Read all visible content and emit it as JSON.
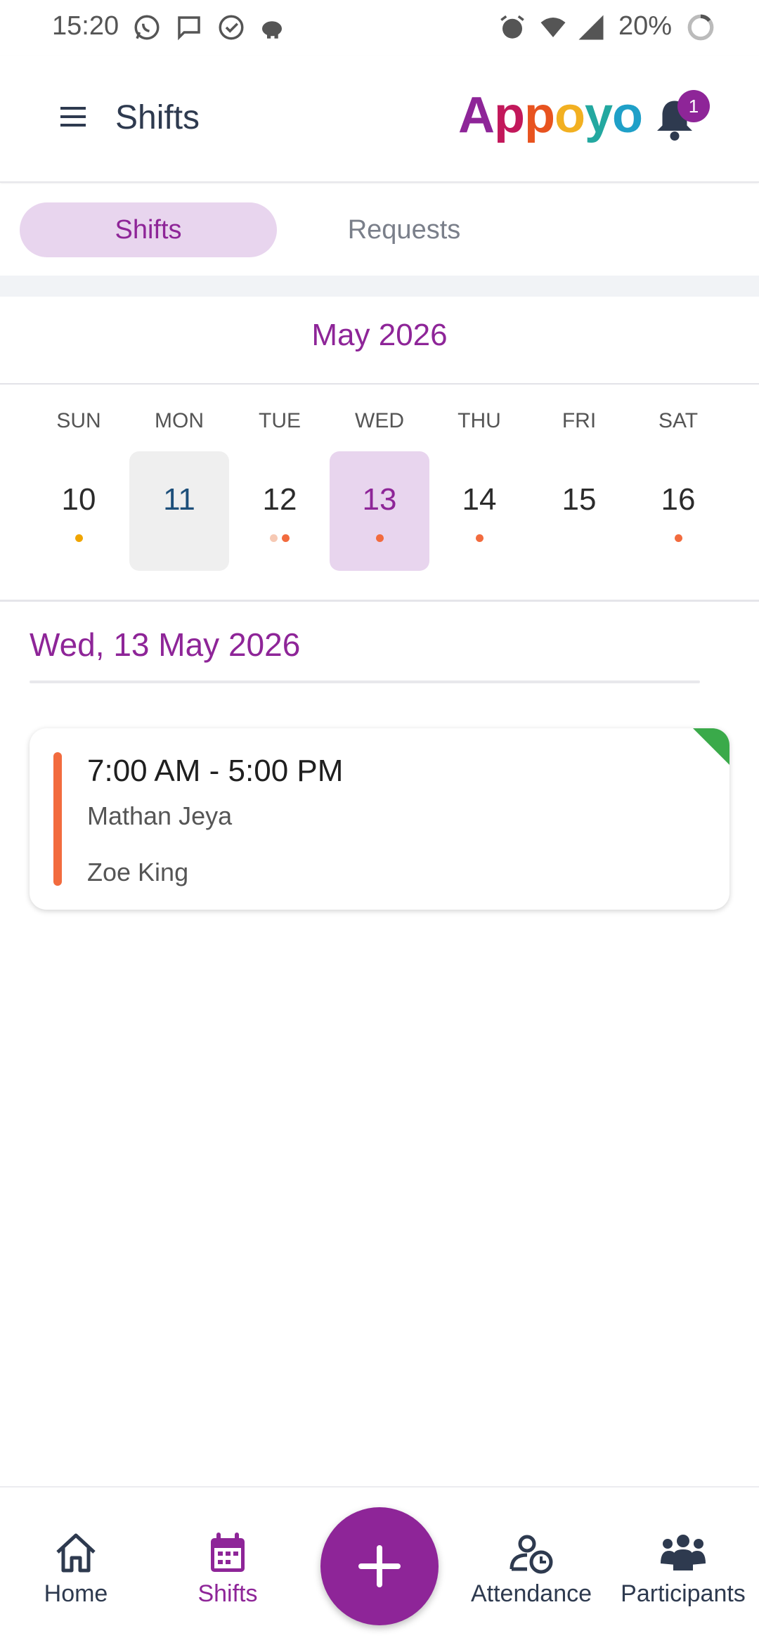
{
  "status_bar": {
    "time": "15:20",
    "battery": "20%"
  },
  "app_bar": {
    "title": "Shifts",
    "brand": [
      "A",
      "p",
      "p",
      "o",
      "y",
      "o"
    ],
    "brand_colors": [
      "#8e2598",
      "#c2185b",
      "#e8531f",
      "#f2b021",
      "#23a8a0",
      "#1fa0c8"
    ],
    "notification_count": "1"
  },
  "tabs": {
    "shifts": "Shifts",
    "requests": "Requests"
  },
  "calendar": {
    "month": "May 2026",
    "days": [
      {
        "dow": "SUN",
        "date": "10",
        "dots": [
          "#f0a500"
        ]
      },
      {
        "dow": "MON",
        "date": "11",
        "dots": []
      },
      {
        "dow": "TUE",
        "date": "12",
        "dots": [
          "#f6c9b4",
          "#f26b3e"
        ]
      },
      {
        "dow": "WED",
        "date": "13",
        "dots": [
          "#f26b3e"
        ]
      },
      {
        "dow": "THU",
        "date": "14",
        "dots": [
          "#f26b3e"
        ]
      },
      {
        "dow": "FRI",
        "date": "15",
        "dots": []
      },
      {
        "dow": "SAT",
        "date": "16",
        "dots": [
          "#f26b3e"
        ]
      }
    ],
    "today_index": 1,
    "selected_index": 3
  },
  "selected_date": "Wed, 13 May 2026",
  "shift": {
    "time": "7:00 AM - 5:00 PM",
    "worker": "Mathan Jeya",
    "participant": "Zoe King",
    "accent_color": "#f26b3e",
    "corner_color": "#3aaa4a"
  },
  "bottom_nav": {
    "home": "Home",
    "shifts": "Shifts",
    "attendance": "Attendance",
    "participants": "Participants"
  },
  "colors": {
    "primary": "#8e2598",
    "navy": "#2e3a4f"
  }
}
